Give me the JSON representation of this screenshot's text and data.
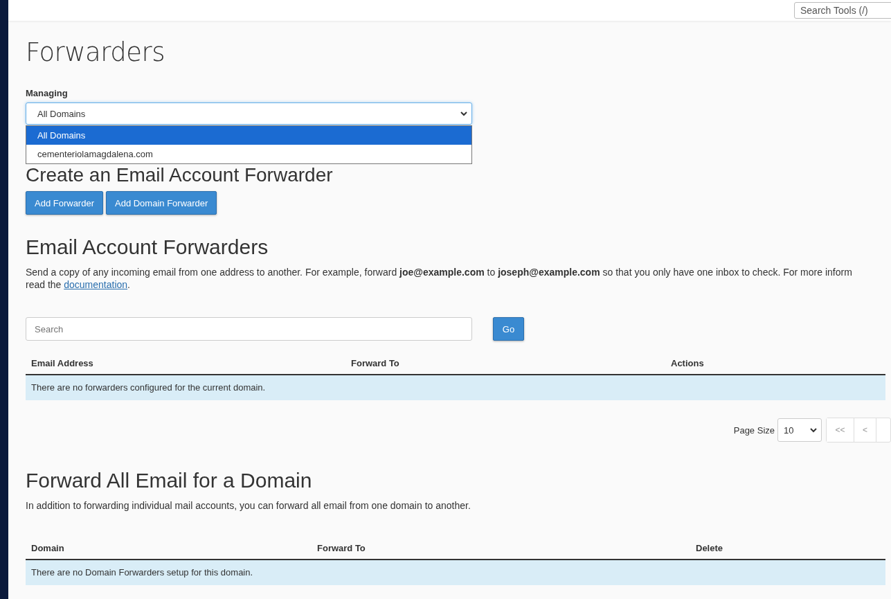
{
  "header": {
    "search": {
      "placeholder": "Search Tools (/)"
    }
  },
  "title": "Forwarders",
  "managing": {
    "label": "Managing",
    "value": "All Domains",
    "expanded": true,
    "options": [
      {
        "label": "All Domains",
        "selected": true
      },
      {
        "label": "cementeriolamagdalena.com",
        "selected": false
      }
    ]
  },
  "create": {
    "heading": "Create an Email Account Forwarder",
    "buttons": [
      "Add Forwarder",
      "Add Domain Forwarder"
    ]
  },
  "account_forwarders": {
    "heading": "Email Account Forwarders",
    "description": "Send a copy of any incoming email from one address to another. For example, forward **joe@example.com** to **joseph@example.com** so that you only have one inbox to check. For more inform",
    "description_line2": "read the",
    "link": "documentation",
    "link_suffix": ".",
    "search": {
      "placeholder": "Search"
    },
    "go": "Go",
    "columns": [
      "Email Address",
      "Forward To",
      "Actions"
    ],
    "empty": "There are no forwarders configured for the current domain.",
    "page_size_label": "Page Size",
    "page_size": "10",
    "pager": [
      "<<",
      "<"
    ]
  },
  "domain_forwarders": {
    "heading": "Forward All Email for a Domain",
    "description": "In addition to forwarding individual mail accounts, you can forward all email from one domain to another.",
    "columns": [
      "Domain",
      "Forward To",
      "Delete"
    ],
    "empty": "There are no Domain Forwarders setup for this domain."
  }
}
